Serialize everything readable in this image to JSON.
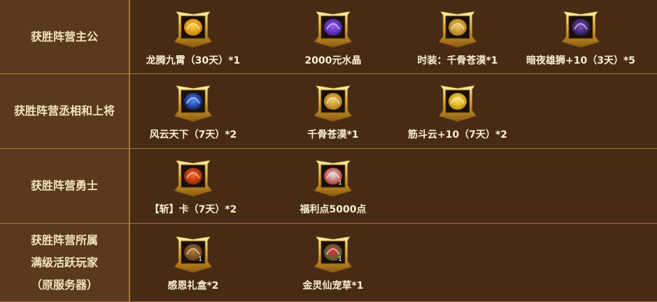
{
  "rows": [
    {
      "label": [
        "获胜阵营主公"
      ],
      "items": [
        {
          "name": "龙腾九霄（30天）*1",
          "icon": "golden-dragon-icon",
          "colors": [
            "#ffd23a",
            "#c57a06"
          ]
        },
        {
          "name": "2000元水晶",
          "icon": "purple-crystal-icon",
          "colors": [
            "#9b5cff",
            "#3c1b8c"
          ]
        },
        {
          "name": "时装：千骨苍漠*1",
          "icon": "golden-costume-icon",
          "colors": [
            "#f2c95a",
            "#a8731c"
          ]
        },
        {
          "name": "暗夜雄狮+10（3天）*5",
          "icon": "dark-lion-mount-icon",
          "colors": [
            "#7a4fc8",
            "#24123c"
          ],
          "count": ""
        }
      ]
    },
    {
      "label": [
        "获胜阵营丞相和上将"
      ],
      "items": [
        {
          "name": "风云天下（7天）*2",
          "icon": "blue-storm-icon",
          "colors": [
            "#4f8cff",
            "#0b1d5e"
          ],
          "count": ""
        },
        {
          "name": "千骨苍漠*1",
          "icon": "golden-costume-icon",
          "colors": [
            "#f2c95a",
            "#a8731c"
          ]
        },
        {
          "name": "筋斗云+10（7天）*2",
          "icon": "golden-cloud-icon",
          "colors": [
            "#ffe45a",
            "#b98b06"
          ]
        }
      ]
    },
    {
      "label": [
        "获胜阵营勇士"
      ],
      "items": [
        {
          "name": "【斩】卡（7天）*2",
          "icon": "slash-card-icon",
          "colors": [
            "#ff6a2a",
            "#8a1d05"
          ]
        },
        {
          "name": "福利点5000点",
          "icon": "welfare-ticket-icon",
          "colors": [
            "#e0e0e0",
            "#b3261e"
          ],
          "count": "1"
        }
      ]
    },
    {
      "label": [
        "获胜阵营所属",
        "满级活跃玩家",
        "（原服务器）"
      ],
      "items": [
        {
          "name": "感恩礼盒*2",
          "icon": "gift-box-icon",
          "colors": [
            "#b07a3c",
            "#5c3612"
          ],
          "count": "1"
        },
        {
          "name": "金灵仙宠草*1",
          "icon": "red-flower-icon",
          "colors": [
            "#e0303a",
            "#2f6b2a"
          ],
          "count": "1"
        }
      ]
    }
  ]
}
